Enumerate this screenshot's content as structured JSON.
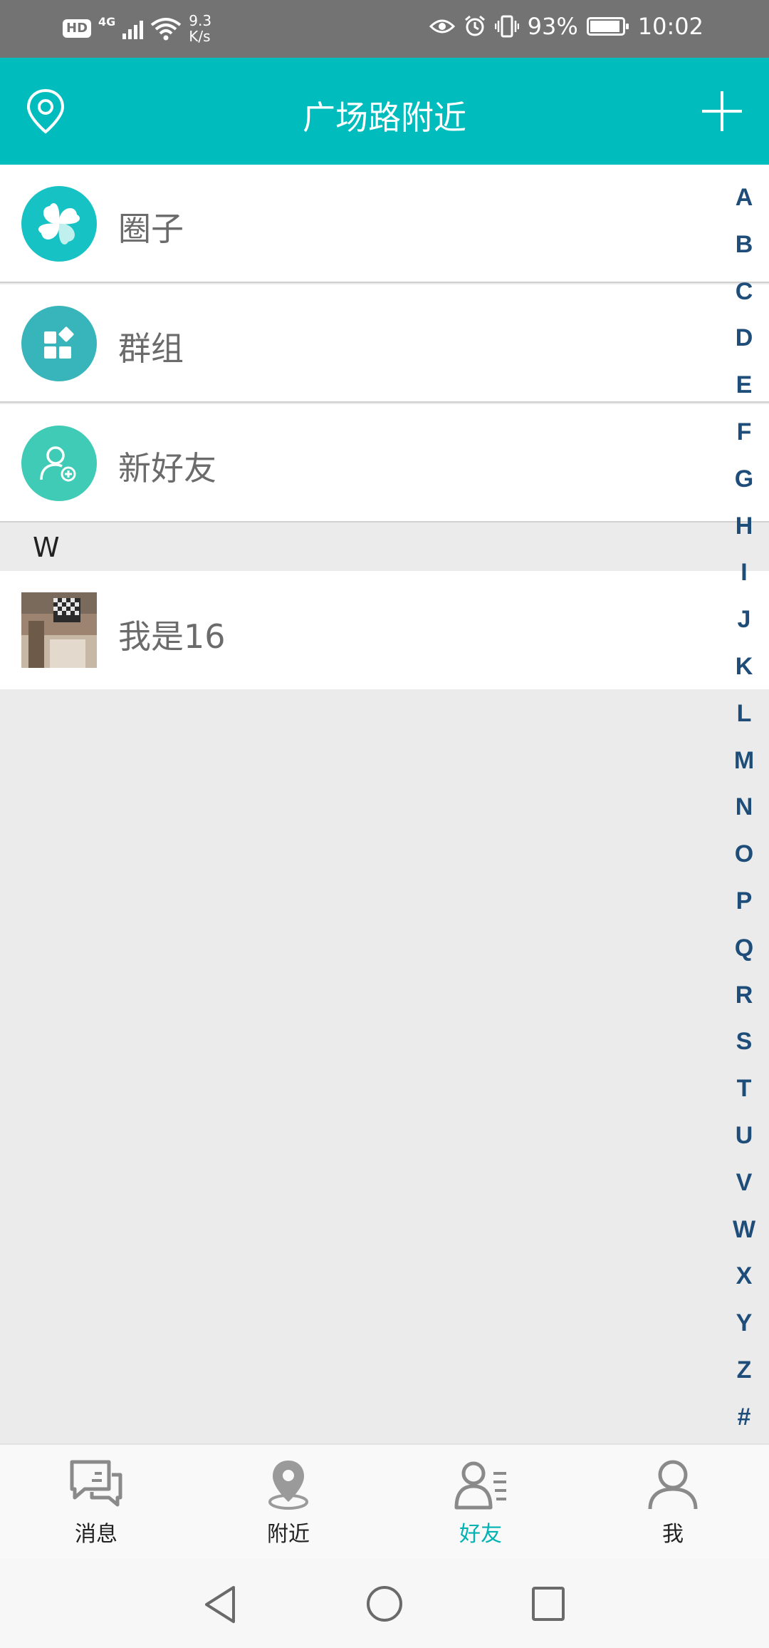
{
  "status_bar": {
    "hd": "HD",
    "network": "4G",
    "speed_value": "9.3",
    "speed_unit": "K/s",
    "battery": "93%",
    "battery_level": 0.93,
    "time": "10:02"
  },
  "header": {
    "title": "广场路附近",
    "location_icon": "location-pin-icon",
    "add_icon": "plus-icon"
  },
  "menu": [
    {
      "label": "圈子",
      "icon": "clover-icon",
      "color": "#17c2c4"
    },
    {
      "label": "群组",
      "icon": "apps-grid-icon",
      "color": "#38b5bb"
    },
    {
      "label": "新好友",
      "icon": "add-friend-icon",
      "color": "#3fcbb6"
    }
  ],
  "section_letter": "W",
  "contacts": [
    {
      "name": "我是16"
    }
  ],
  "alphabet_index": [
    "A",
    "B",
    "C",
    "D",
    "E",
    "F",
    "G",
    "H",
    "I",
    "J",
    "K",
    "L",
    "M",
    "N",
    "O",
    "P",
    "Q",
    "R",
    "S",
    "T",
    "U",
    "V",
    "W",
    "X",
    "Y",
    "Z",
    "#"
  ],
  "tabs": [
    {
      "label": "消息",
      "icon": "chat-bubbles-icon",
      "active": false
    },
    {
      "label": "附近",
      "icon": "map-pin-icon",
      "active": false
    },
    {
      "label": "好友",
      "icon": "friends-list-icon",
      "active": true
    },
    {
      "label": "我",
      "icon": "profile-icon",
      "active": false
    }
  ],
  "colors": {
    "accent": "#00bcbc",
    "index_letters": "#1e4d79",
    "active_tab": "#00b3b3",
    "status_bar": "#737373"
  }
}
